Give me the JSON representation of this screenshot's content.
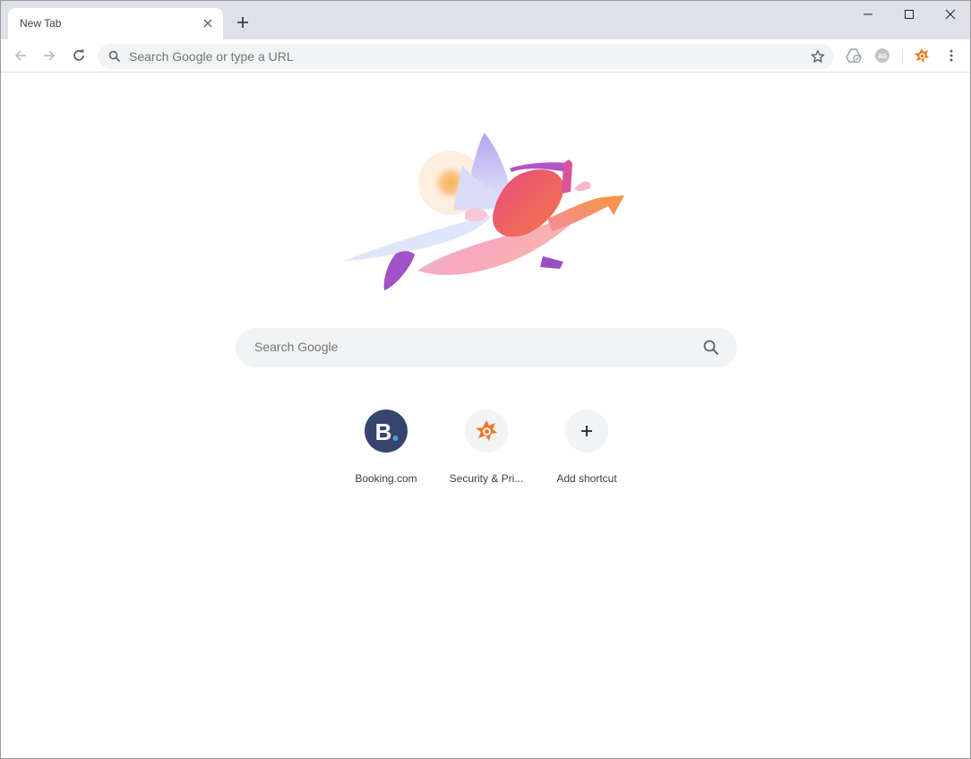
{
  "tab": {
    "title": "New Tab"
  },
  "omnibox": {
    "placeholder": "Search Google or type a URL"
  },
  "search": {
    "placeholder": "Search Google"
  },
  "shortcuts": [
    {
      "label": "Booking.com",
      "letter": "B",
      "color": "#35456e",
      "dot_color": "#4aa0db"
    },
    {
      "label": "Security & Pri...",
      "icon": "avast-icon",
      "color": "#f47321"
    },
    {
      "label": "Add shortcut",
      "icon": "plus-icon"
    }
  ],
  "extensions": [
    {
      "name": "drive-extension-icon"
    },
    {
      "name": "adblock-extension-icon",
      "text": "AD"
    },
    {
      "name": "avast-extension-icon",
      "color": "#f47321"
    }
  ],
  "colors": {
    "tabstrip": "#dee1e6",
    "omnibox": "#f1f3f4",
    "text": "#3c4043"
  }
}
